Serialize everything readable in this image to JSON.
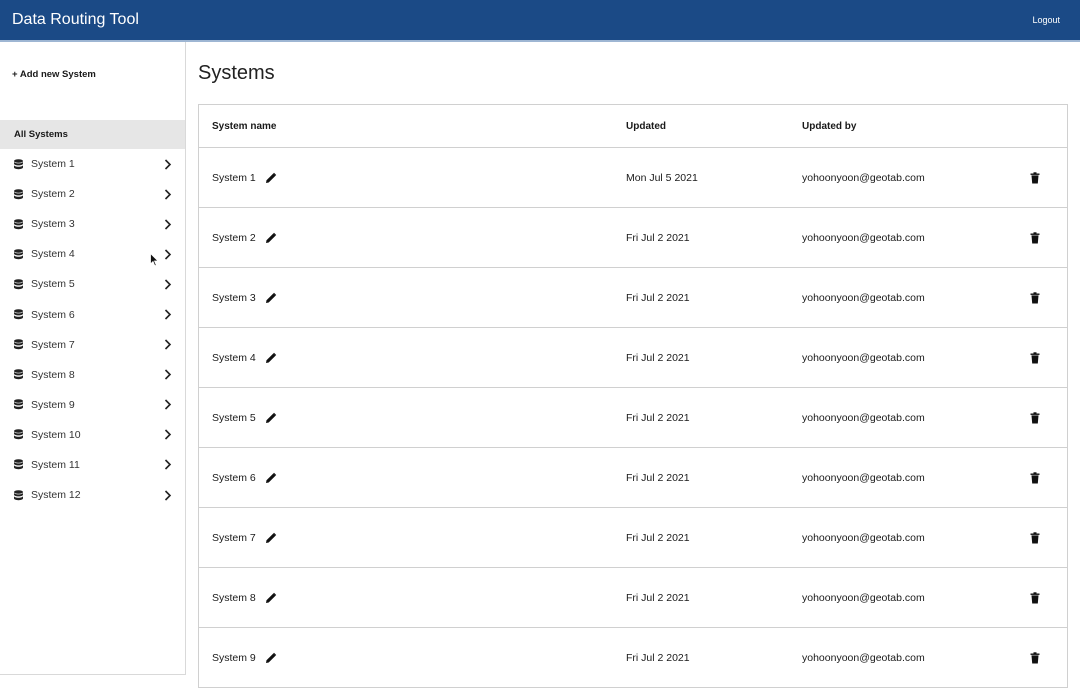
{
  "header": {
    "title": "Data Routing Tool",
    "logout_label": "Logout"
  },
  "sidebar": {
    "add_label": "+ Add new System",
    "all_label": "All Systems",
    "items": [
      {
        "label": "System 1"
      },
      {
        "label": "System 2"
      },
      {
        "label": "System 3"
      },
      {
        "label": "System 4"
      },
      {
        "label": "System 5"
      },
      {
        "label": "System 6"
      },
      {
        "label": "System 7"
      },
      {
        "label": "System 8"
      },
      {
        "label": "System 9"
      },
      {
        "label": "System 10"
      },
      {
        "label": "System 11"
      },
      {
        "label": "System 12"
      }
    ],
    "item_icon": "database-icon",
    "chevron_icon": "chevron-right-icon"
  },
  "main": {
    "title": "Systems",
    "columns": {
      "name": "System name",
      "updated": "Updated",
      "updated_by": "Updated by"
    },
    "rows": [
      {
        "name": "System 1",
        "updated": "Mon Jul 5 2021",
        "by": "yohoonyoon@geotab.com"
      },
      {
        "name": "System 2",
        "updated": "Fri Jul 2 2021",
        "by": "yohoonyoon@geotab.com"
      },
      {
        "name": "System 3",
        "updated": "Fri Jul 2 2021",
        "by": "yohoonyoon@geotab.com"
      },
      {
        "name": "System 4",
        "updated": "Fri Jul 2 2021",
        "by": "yohoonyoon@geotab.com"
      },
      {
        "name": "System 5",
        "updated": "Fri Jul 2 2021",
        "by": "yohoonyoon@geotab.com"
      },
      {
        "name": "System 6",
        "updated": "Fri Jul 2 2021",
        "by": "yohoonyoon@geotab.com"
      },
      {
        "name": "System 7",
        "updated": "Fri Jul 2 2021",
        "by": "yohoonyoon@geotab.com"
      },
      {
        "name": "System 8",
        "updated": "Fri Jul 2 2021",
        "by": "yohoonyoon@geotab.com"
      },
      {
        "name": "System 9",
        "updated": "Fri Jul 2 2021",
        "by": "yohoonyoon@geotab.com"
      }
    ],
    "edit_icon": "pencil-icon",
    "delete_icon": "trash-icon"
  },
  "colors": {
    "header_bg": "#1b4a86",
    "selected_bg": "#e6e6e6",
    "border": "#d0d0d0"
  }
}
